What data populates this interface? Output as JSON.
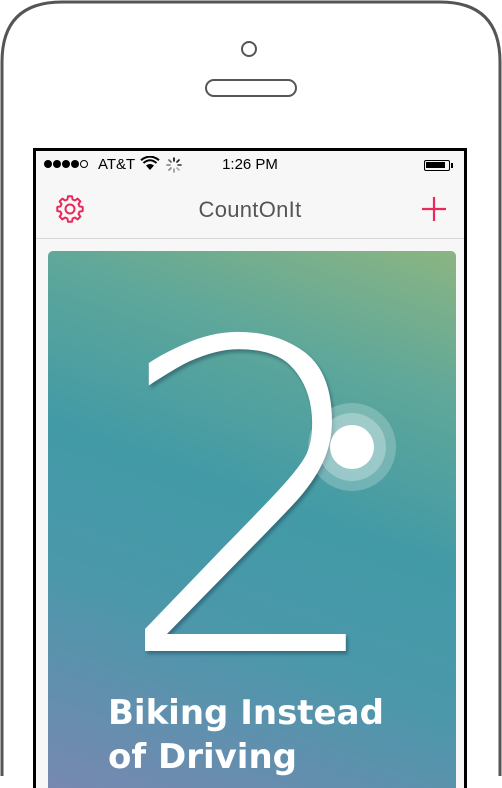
{
  "status_bar": {
    "carrier": "AT&T",
    "time": "1:26 PM"
  },
  "nav": {
    "title": "CountOnIt",
    "left_icon": "gear-icon",
    "right_icon": "plus-icon"
  },
  "counter": {
    "count": "2",
    "title": "Biking Instead of Driving"
  },
  "colors": {
    "accent": "#e8295a",
    "nav_title": "#555555",
    "card_top": "#8bb582",
    "card_mid": "#429aa6",
    "card_bottom": "#7c87b1"
  }
}
